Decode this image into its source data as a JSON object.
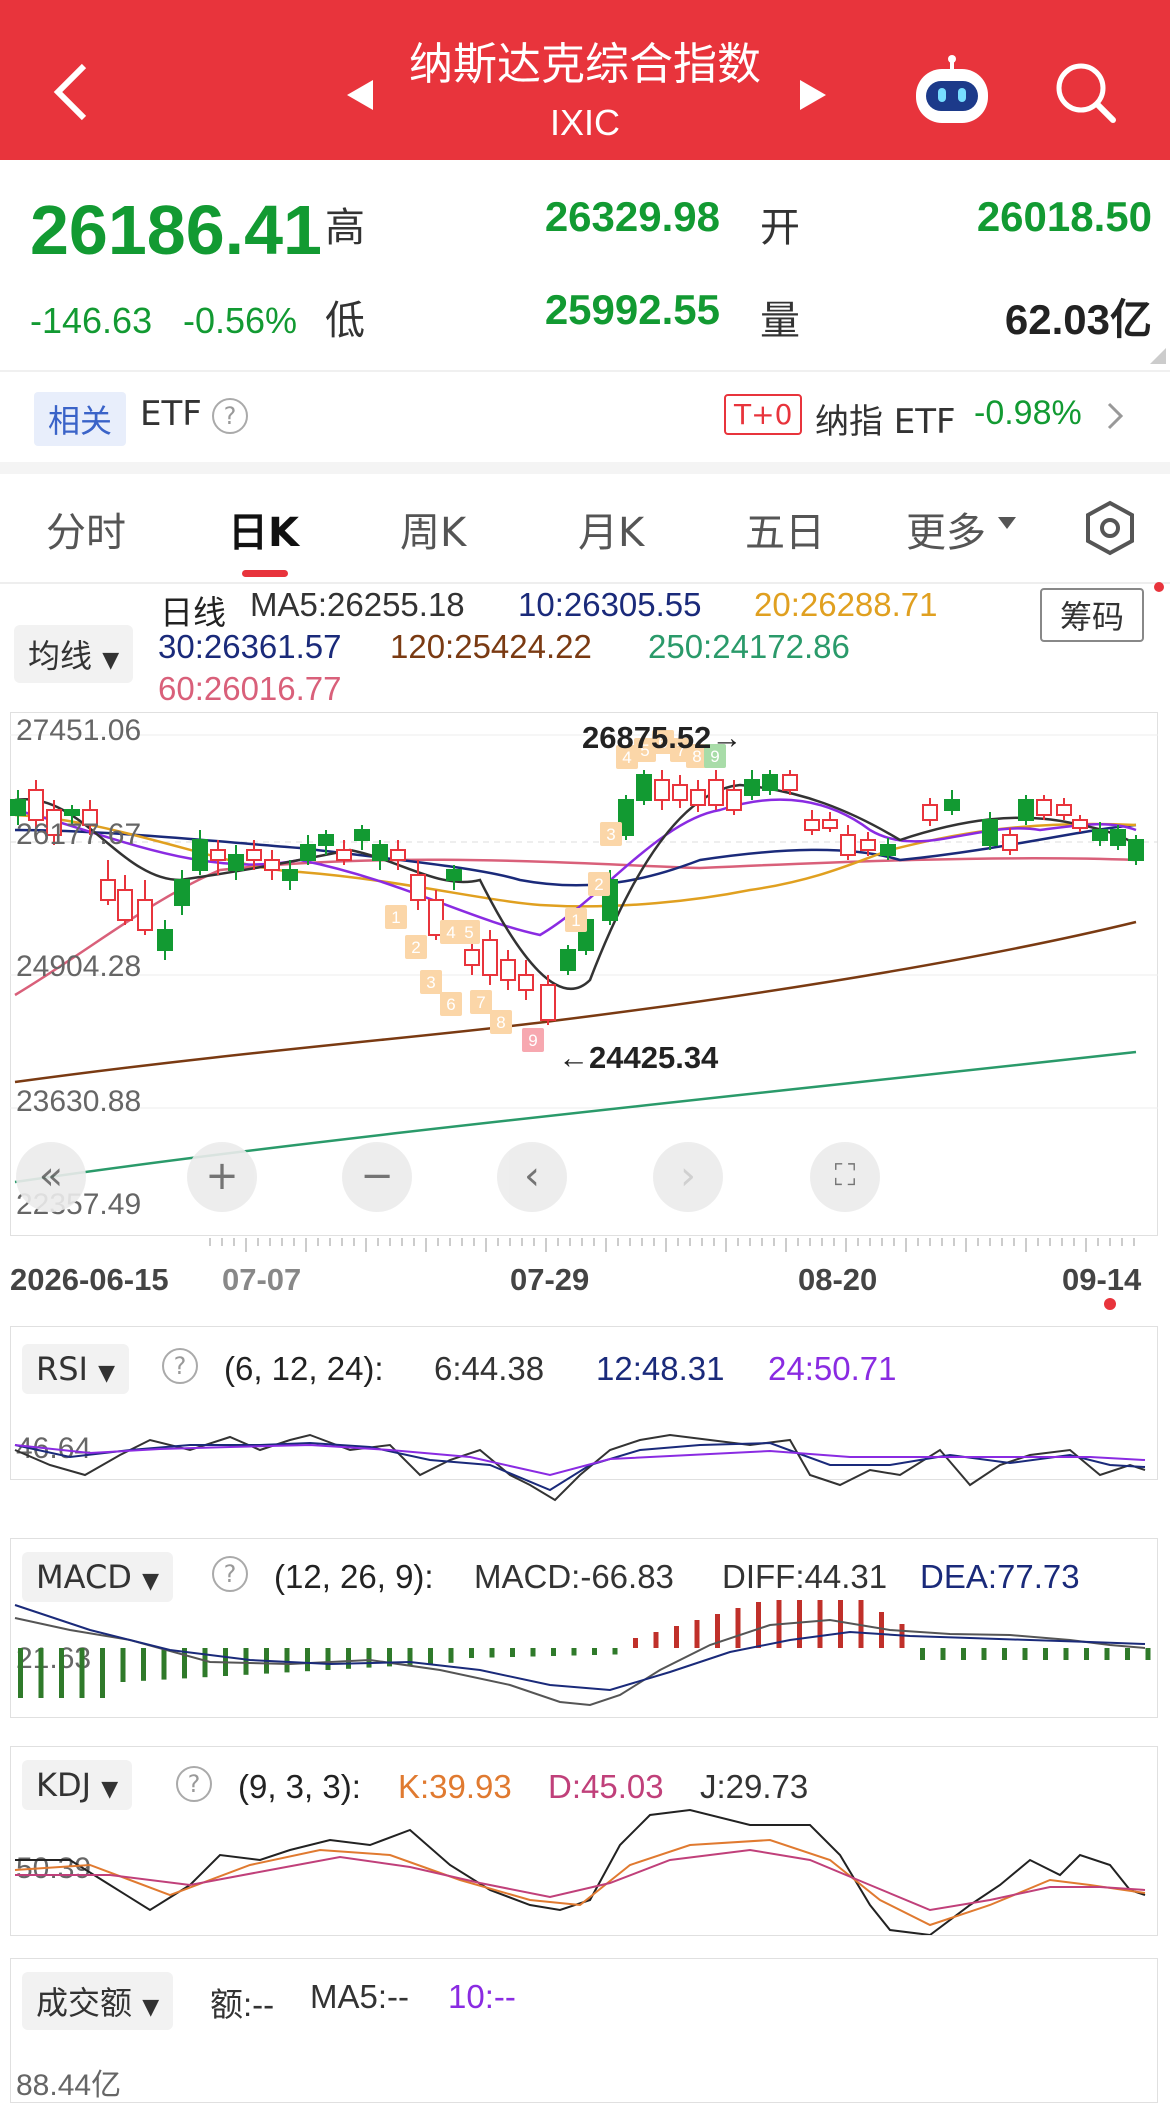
{
  "header": {
    "title": "纳斯达克综合指数",
    "code": "IXIC"
  },
  "quote": {
    "price": "26186.41",
    "change": "-146.63",
    "change_pct": "-0.56%",
    "high_label": "高",
    "high": "26329.98",
    "open_label": "开",
    "open": "26018.50",
    "low_label": "低",
    "low": "25992.55",
    "volume_label": "量",
    "volume": "62.03亿"
  },
  "etf": {
    "tag": "相关",
    "label": "ETF",
    "t0": "T+0",
    "name": "纳指 ETF",
    "pct": "-0.98%"
  },
  "tabs": [
    "分时",
    "日K",
    "周K",
    "月K",
    "五日",
    "更多"
  ],
  "ma": {
    "select": "均线",
    "line_label": "日线",
    "chips_button": "筹码",
    "ma5": "MA5:26255.18",
    "ma10": "10:26305.55",
    "ma20": "20:26288.71",
    "ma30": "30:26361.57",
    "ma120": "120:25424.22",
    "ma250": "250:24172.86",
    "ma60": "60:26016.77"
  },
  "kline": {
    "y_labels": [
      "27451.06",
      "26177.67",
      "24904.28",
      "23630.88",
      "22357.49"
    ],
    "high_mark": "26875.52→",
    "low_mark": "←24425.34",
    "dates": [
      "2026-06-15",
      "07-07",
      "07-29",
      "08-20",
      "09-14"
    ],
    "td_labels_1": [
      "1",
      "2",
      "3",
      "4",
      "5",
      "6",
      "7",
      "8",
      "9"
    ],
    "td_labels_2": [
      "1",
      "2",
      "3",
      "4",
      "5",
      "6",
      "7",
      "8",
      "9"
    ],
    "td_labels_3": [
      "1",
      "2",
      "3"
    ],
    "td_labels_4": [
      "4",
      "5",
      "6",
      "7",
      "8",
      "9"
    ]
  },
  "colors": {
    "red": "#e8343c",
    "green": "#129a32",
    "ma5": "#333333",
    "ma10": "#1a2a7a",
    "ma20": "#e0a020",
    "ma30": "#8a2be2",
    "ma60": "#d9607a",
    "ma120": "#7a3a12",
    "ma250": "#2a9a6a"
  },
  "rsi": {
    "name": "RSI",
    "params": "(6, 12, 24):",
    "v6": "6:44.38",
    "v12": "12:48.31",
    "v24": "24:50.71",
    "axis": "46.64"
  },
  "macd": {
    "name": "MACD",
    "params": "(12, 26, 9):",
    "macd": "MACD:-66.83",
    "diff": "DIFF:44.31",
    "dea": "DEA:77.73",
    "axis": "21.63"
  },
  "kdj": {
    "name": "KDJ",
    "params": "(9, 3, 3):",
    "k": "K:39.93",
    "d": "D:45.03",
    "j": "J:29.73",
    "axis": "50.39"
  },
  "amount": {
    "name": "成交额",
    "amt": "额:--",
    "ma5": "MA5:--",
    "ma10": "10:--",
    "axis": "88.44亿"
  }
}
